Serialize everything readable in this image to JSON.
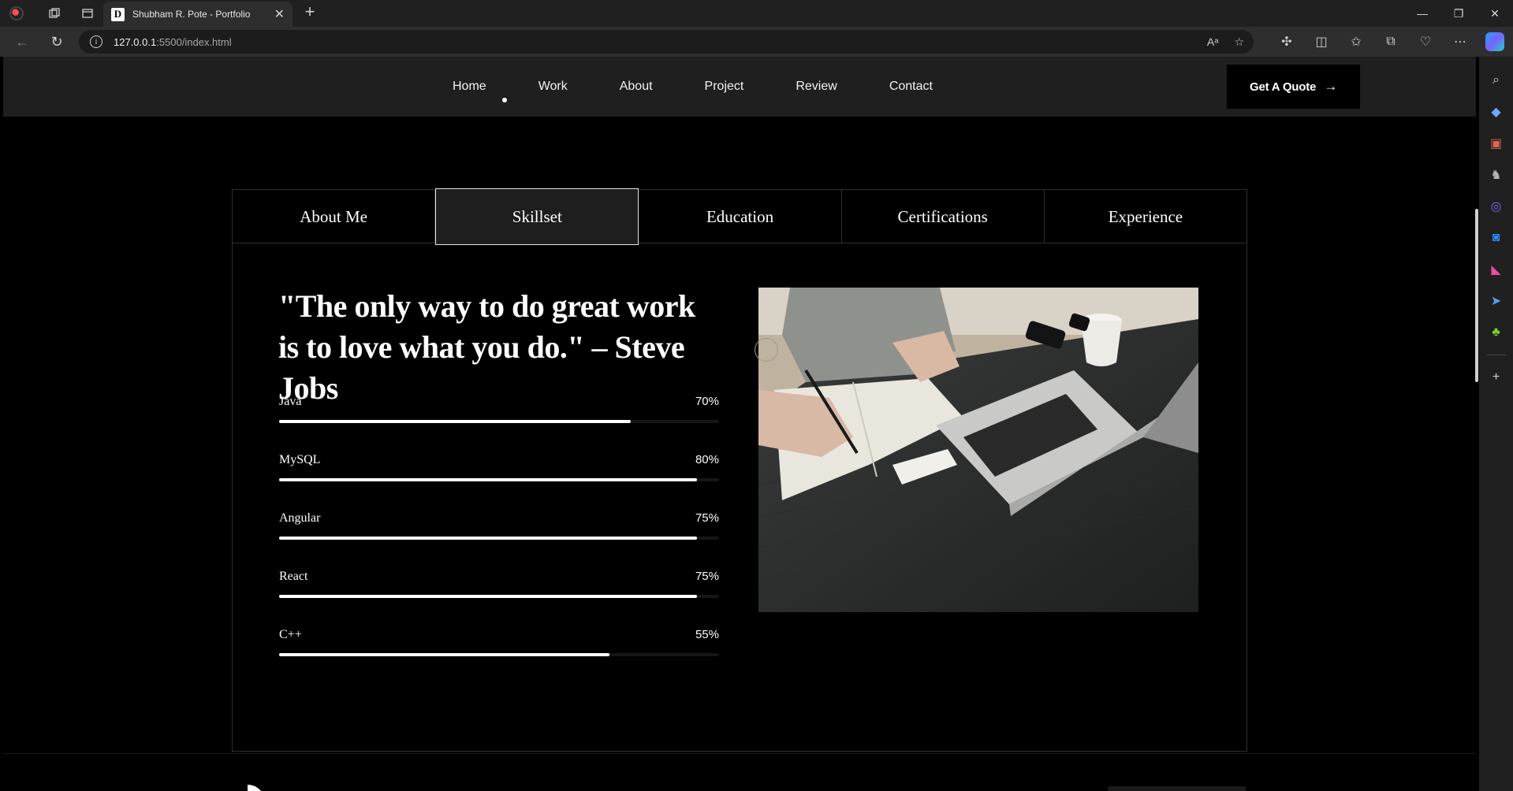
{
  "browser": {
    "tab_title": "Shubham R. Pote - Portfolio",
    "tab_favicon": "D",
    "url_host": "127.0.0.1",
    "url_path": ":5500/index.html"
  },
  "nav": {
    "items": [
      "Home",
      "Work",
      "About",
      "Project",
      "Review",
      "Contact"
    ],
    "cta_label": "Get A Quote"
  },
  "tabs": [
    "About Me",
    "Skillset",
    "Education",
    "Certifications",
    "Experience"
  ],
  "active_tab": "Skillset",
  "quote": "\"The only way to do great work is to love what you do.\" – Steve Jobs",
  "skills": [
    {
      "name": "Java",
      "percent_label": "70%",
      "fill_fraction": 0.8
    },
    {
      "name": "MySQL",
      "percent_label": "80%",
      "fill_fraction": 0.95
    },
    {
      "name": "Angular",
      "percent_label": "75%",
      "fill_fraction": 0.95
    },
    {
      "name": "React",
      "percent_label": "75%",
      "fill_fraction": 0.95
    },
    {
      "name": "C++",
      "percent_label": "55%",
      "fill_fraction": 0.75
    }
  ],
  "colors": {
    "page_bg": "#000000",
    "header_bg": "#1f1f1f",
    "accent": "#ffffff",
    "panel_border": "#2f2f2f"
  }
}
